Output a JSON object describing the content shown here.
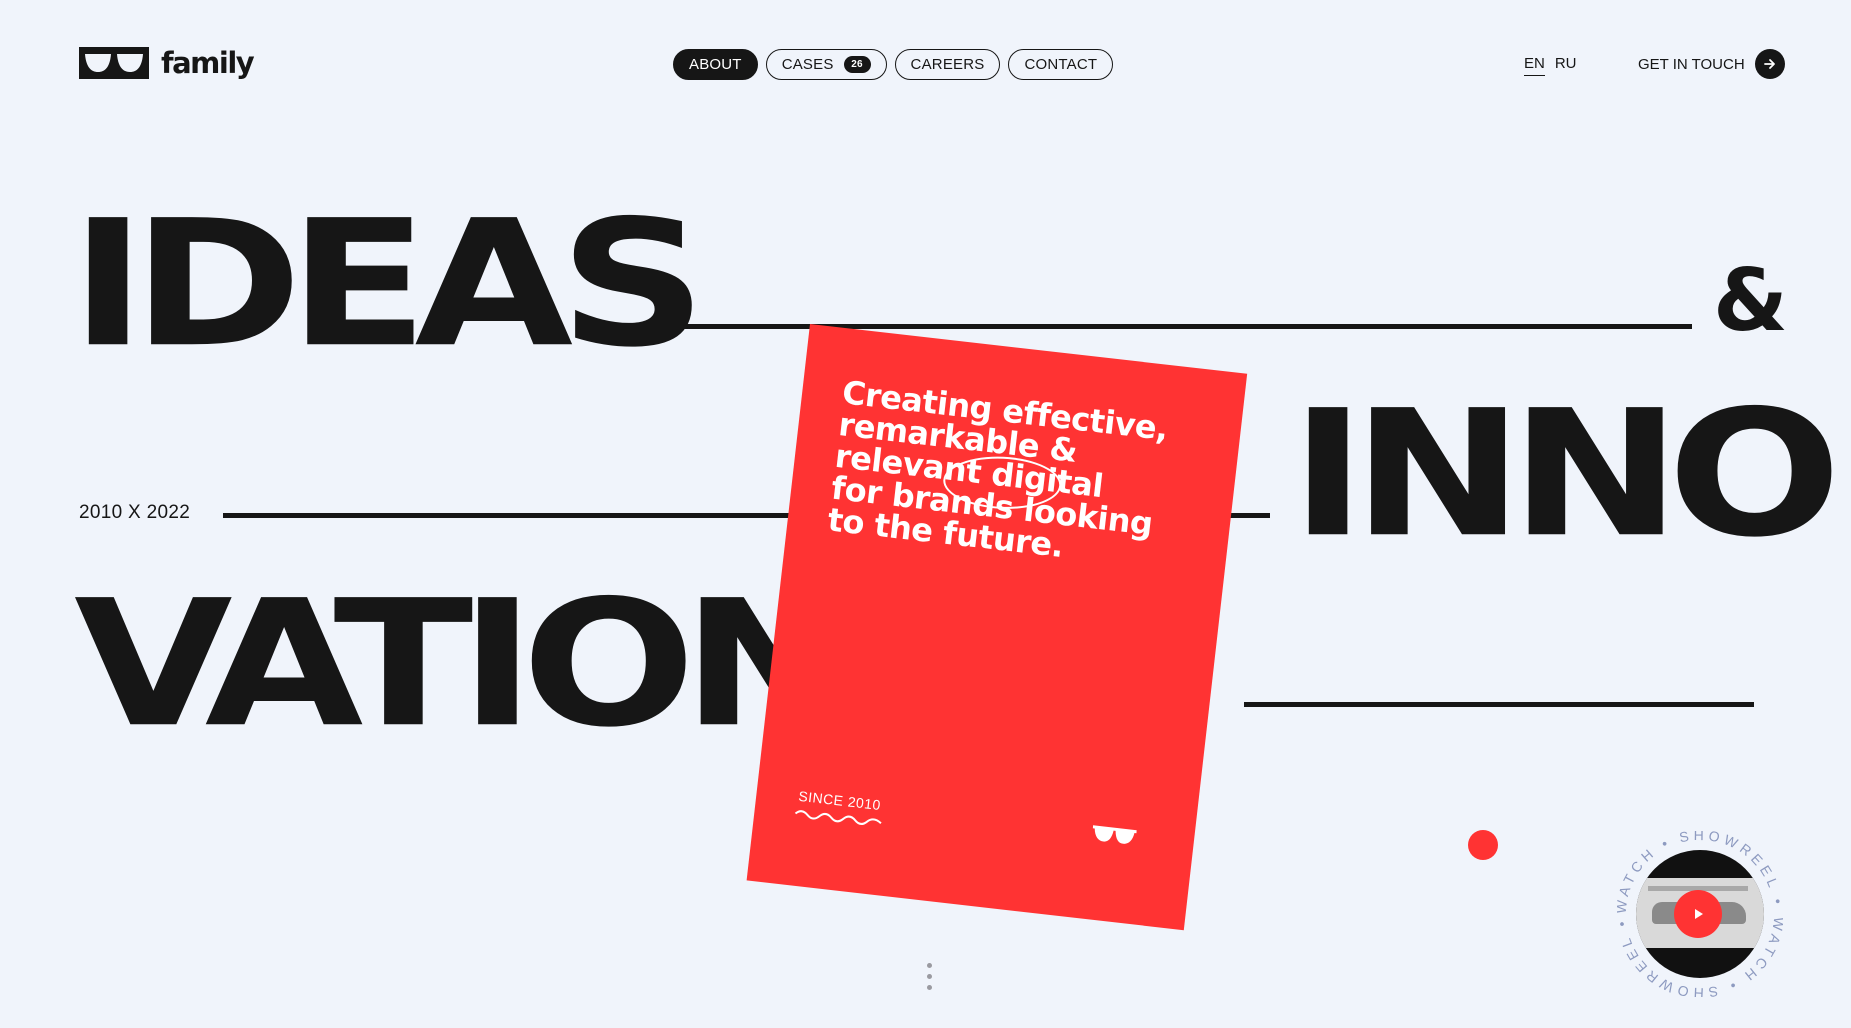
{
  "brand": {
    "name": "family",
    "logo_icon": "sunglasses-icon"
  },
  "nav": {
    "items": [
      {
        "label": "ABOUT",
        "active": true
      },
      {
        "label": "CASES",
        "badge": "26"
      },
      {
        "label": "CAREERS"
      },
      {
        "label": "CONTACT"
      }
    ]
  },
  "lang": {
    "en": "EN",
    "ru": "RU",
    "current": "EN"
  },
  "cta": {
    "label": "GET IN TOUCH",
    "icon": "arrow-right-icon"
  },
  "hero": {
    "word1": "IDEAS",
    "amp": "&",
    "word2": "INNO",
    "word3": "VATION",
    "years": "2010 X 2022"
  },
  "card": {
    "line1": "Creating effective,",
    "line2": "remarkable &",
    "line3": "relevant digital",
    "line4": "for brands looking",
    "line5": "to the future.",
    "since": "SINCE 2010"
  },
  "showreel": {
    "ring_text": "WATCH • SHOWREEL • WATCH • SHOWREEL •",
    "icon": "play-icon"
  },
  "colors": {
    "accent": "#ff3333",
    "ink": "#161616",
    "background": "#f0f4fb"
  }
}
